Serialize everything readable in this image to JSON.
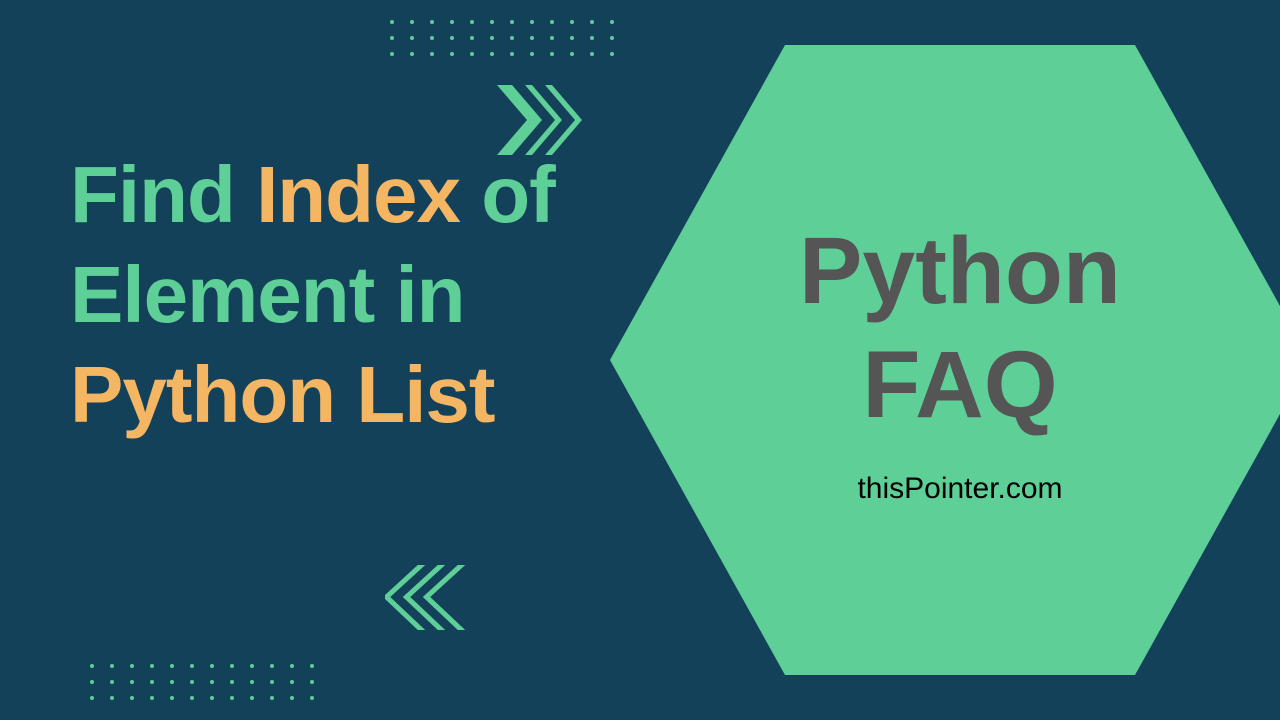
{
  "title": {
    "line1_part1": "Find ",
    "line1_part2": "Index",
    "line1_part3": " of",
    "line2": "Element in",
    "line3": "Python List"
  },
  "hexagon": {
    "line1": "Python",
    "line2": "FAQ",
    "subtitle": "thisPointer.com"
  },
  "colors": {
    "bg": "#14415a",
    "green": "#5fcf98",
    "yellow": "#f4b663",
    "hex_text": "#555555"
  }
}
